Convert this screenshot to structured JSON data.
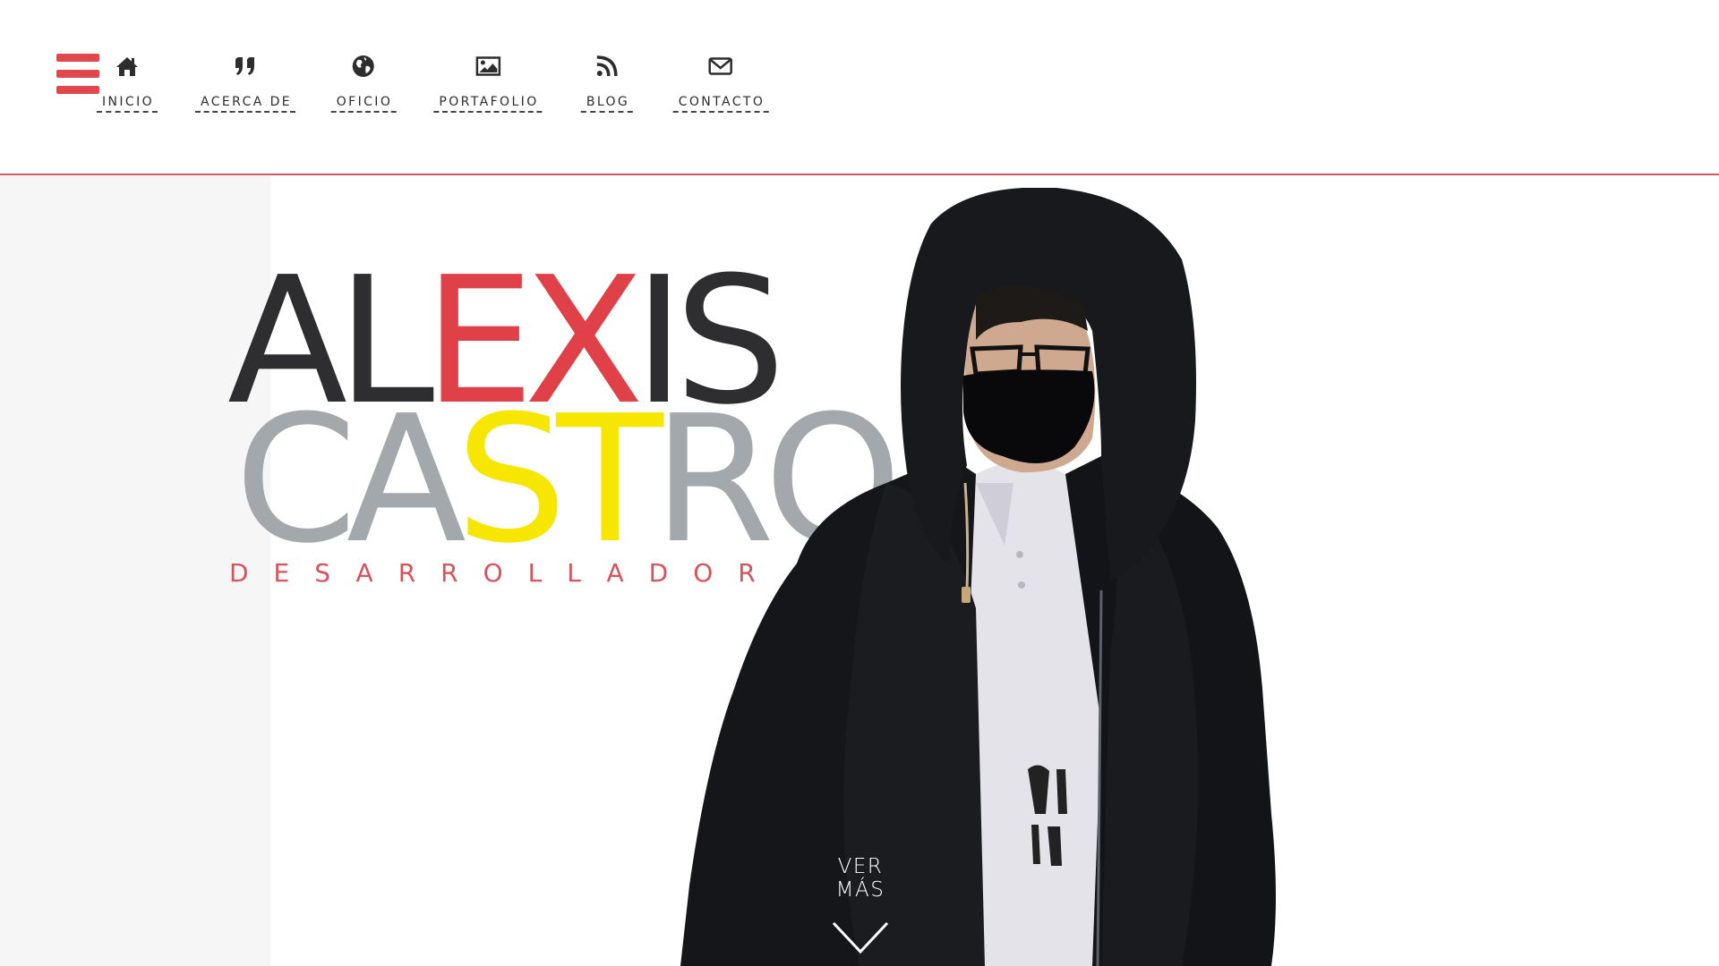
{
  "header": {
    "menu_icon": "hamburger-menu-icon",
    "nav": [
      {
        "label": "INICIO",
        "icon": "home-icon"
      },
      {
        "label": "ACERCA DE",
        "icon": "quote-icon"
      },
      {
        "label": "OFICIO",
        "icon": "globe-icon"
      },
      {
        "label": "PORTAFOLIO",
        "icon": "image-icon"
      },
      {
        "label": "BLOG",
        "icon": "rss-icon"
      },
      {
        "label": "CONTACTO",
        "icon": "envelope-icon"
      }
    ]
  },
  "hero": {
    "first_name": {
      "dark_a": "AL",
      "red": "EX",
      "dark_b": "IS"
    },
    "last_name": {
      "grey_a": "CA",
      "yellow": "ST",
      "grey_b": "RO"
    },
    "role": "DESARROLLADOR",
    "cta": {
      "label": "VER MÁS",
      "icon": "chevron-down-icon"
    }
  },
  "colors": {
    "accent_red": "#e0484d",
    "dark_text": "#2e2e30",
    "grey_text": "#a3a8ad",
    "yellow": "#f6e600",
    "header_border": "#d9595f"
  }
}
